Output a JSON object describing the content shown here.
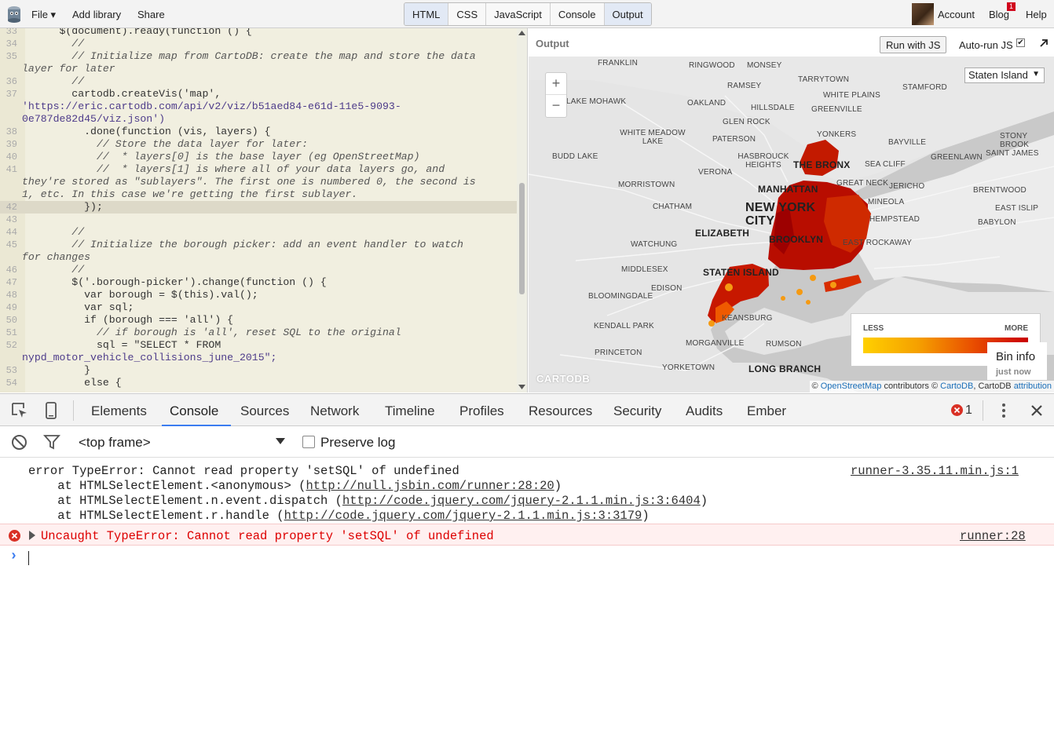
{
  "topbar": {
    "menu": {
      "file": "File ▾",
      "add_library": "Add library",
      "share": "Share"
    },
    "panels": [
      "HTML",
      "CSS",
      "JavaScript",
      "Console",
      "Output"
    ],
    "account": "Account",
    "blog": "Blog",
    "blog_badge": "1",
    "help": "Help"
  },
  "editor": {
    "lines": [
      {
        "n": "33",
        "t": "      $(document).ready(function () {"
      },
      {
        "n": "34",
        "t": "        //"
      },
      {
        "n": "35",
        "t": "        // Initialize map from CartoDB: create the map and store the data"
      },
      {
        "n": "",
        "t": "layer for later"
      },
      {
        "n": "36",
        "t": "        //"
      },
      {
        "n": "37",
        "t": "        cartodb.createVis('map',"
      },
      {
        "n": "",
        "t": "'https://eric.cartodb.com/api/v2/viz/b51aed84-e61d-11e5-9093-"
      },
      {
        "n": "",
        "t": "0e787de82d45/viz.json')"
      },
      {
        "n": "38",
        "t": "          .done(function (vis, layers) {"
      },
      {
        "n": "39",
        "t": "            // Store the data layer for later:"
      },
      {
        "n": "40",
        "t": "            //  * layers[0] is the base layer (eg OpenStreetMap)"
      },
      {
        "n": "41",
        "t": "            //  * layers[1] is where all of your data layers go, and"
      },
      {
        "n": "",
        "t": "they're stored as \"sublayers\". The first one is numbered 0, the second is"
      },
      {
        "n": "",
        "t": "1, etc. In this case we're getting the first sublayer."
      },
      {
        "n": "42",
        "t": "          });"
      },
      {
        "n": "43",
        "t": ""
      },
      {
        "n": "44",
        "t": "        //"
      },
      {
        "n": "45",
        "t": "        // Initialize the borough picker: add an event handler to watch"
      },
      {
        "n": "",
        "t": "for changes"
      },
      {
        "n": "46",
        "t": "        //"
      },
      {
        "n": "47",
        "t": "        $('.borough-picker').change(function () {"
      },
      {
        "n": "48",
        "t": "          var borough = $(this).val();"
      },
      {
        "n": "49",
        "t": "          var sql;"
      },
      {
        "n": "50",
        "t": "          if (borough === 'all') {"
      },
      {
        "n": "51",
        "t": "            // if borough is 'all', reset SQL to the original"
      },
      {
        "n": "52",
        "t": "            sql = \"SELECT * FROM"
      },
      {
        "n": "",
        "t": "nypd_motor_vehicle_collisions_june_2015\";"
      },
      {
        "n": "53",
        "t": "          }"
      },
      {
        "n": "54",
        "t": "          else {"
      }
    ]
  },
  "output": {
    "label": "Output",
    "run_button": "Run with JS",
    "autorun_label": "Auto-run JS",
    "map": {
      "borough_select": "Staten Island",
      "zoom_in": "+",
      "zoom_out": "−",
      "labels": [
        "FRANKLIN",
        "RINGWOOD",
        "MONSEY",
        "TARRYTOWN",
        "STAMFORD",
        "LAKE MOHAWK",
        "RAMSEY",
        "OAKLAND",
        "HILLSDALE",
        "WHITE PLAINS",
        "GREENVILLE",
        "GLEN ROCK",
        "WHITE MEADOW LAKE",
        "PATERSON",
        "YONKERS",
        "BAYVILLE",
        "STONY BROOK",
        "BUDD LAKE",
        "HASBROUCK HEIGHTS",
        "THE BRONX",
        "SEA CLIFF",
        "GREENLAWN",
        "SAINT JAMES",
        "VERONA",
        "MORRISTOWN",
        "MANHATTAN",
        "GREAT NECK",
        "JERICHO",
        "BRENTWOOD",
        "CHATHAM",
        "NEW YORK CITY",
        "MINEOLA",
        "EAST ISLIP",
        "ELIZABETH",
        "HEMPSTEAD",
        "BABYLON",
        "WATCHUNG",
        "BROOKLYN",
        "EAST ROCKAWAY",
        "MIDDLESEX",
        "STATEN ISLAND",
        "EDISON",
        "BLOOMINGDALE",
        "KEANSBURG",
        "KENDALL PARK",
        "MORGANVILLE",
        "RUMSON",
        "PRINCETON",
        "YORKETOWN",
        "LONG BRANCH"
      ],
      "legend_less": "LESS",
      "legend_more": "MORE",
      "bin_info_title": "Bin info",
      "bin_info_time": "just now",
      "attribution_prefix": "©",
      "attribution_osm": "OpenStreetMap",
      "attribution_mid": "contributors ©",
      "attribution_cartodb": "CartoDB",
      "attribution_suffix": ", CartoDB",
      "attribution_link": "attribution",
      "watermark": "CARTODB"
    }
  },
  "devtools": {
    "tabs": [
      "Elements",
      "Console",
      "Sources",
      "Network",
      "Timeline",
      "Profiles",
      "Resources",
      "Security",
      "Audits",
      "Ember"
    ],
    "error_count": "1",
    "frame": "<top frame>",
    "preserve_log": "Preserve log",
    "messages": {
      "error_main": "error TypeError: Cannot read property 'setSQL' of undefined",
      "stack1_pre": "    at HTMLSelectElement.<anonymous> (",
      "stack1_link": "http://null.jsbin.com/runner:28:20",
      "stack1_post": ")",
      "stack2_pre": "    at HTMLSelectElement.n.event.dispatch (",
      "stack2_link": "http://code.jquery.com/jquery-2.1.1.min.js:3:6404",
      "stack2_post": ")",
      "stack3_pre": "    at HTMLSelectElement.r.handle (",
      "stack3_link": "http://code.jquery.com/jquery-2.1.1.min.js:3:3179",
      "stack3_post": ")",
      "source1": "runner-3.35.11.min.js:1",
      "uncaught": "Uncaught TypeError: Cannot read property 'setSQL' of undefined",
      "source2": "runner:28",
      "prompt": "›"
    }
  },
  "colors": {
    "accent": "#3b7cf0",
    "error": "#d93025",
    "heat_low": "#f5a623",
    "heat_high": "#b30000"
  }
}
